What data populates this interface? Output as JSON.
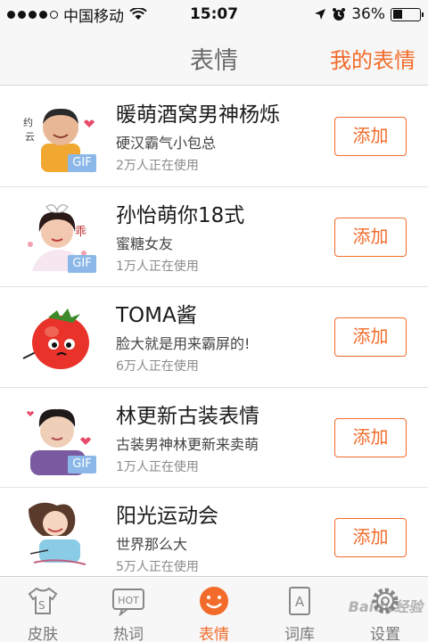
{
  "status_bar": {
    "carrier": "中国移动",
    "time": "15:07",
    "battery": "36%",
    "battery_level": 0.36
  },
  "nav": {
    "title": "表情",
    "right_action": "我的表情"
  },
  "items": [
    {
      "title": "暖萌酒窝男神杨烁",
      "subtitle": "硬汉霸气小包总",
      "users": "2万人正在使用",
      "badge": "GIF",
      "button": "添加"
    },
    {
      "title": "孙怡萌你18式",
      "subtitle": "蜜糖女友",
      "users": "1万人正在使用",
      "badge": "GIF",
      "button": "添加"
    },
    {
      "title": "TOMA酱",
      "subtitle": "脸大就是用来霸屏的!",
      "users": "6万人正在使用",
      "badge": "",
      "button": "添加"
    },
    {
      "title": "林更新古装表情",
      "subtitle": "古装男神林更新来卖萌",
      "users": "1万人正在使用",
      "badge": "GIF",
      "button": "添加"
    },
    {
      "title": "阳光运动会",
      "subtitle": "世界那么大",
      "users": "5万人正在使用",
      "badge": "",
      "button": "添加"
    }
  ],
  "tabs": [
    {
      "label": "皮肤",
      "icon": "tshirt-icon"
    },
    {
      "label": "热词",
      "icon": "hot-icon",
      "icon_text": "HOT"
    },
    {
      "label": "表情",
      "icon": "smiley-icon",
      "active": true
    },
    {
      "label": "词库",
      "icon": "dictionary-icon",
      "icon_text": "A"
    },
    {
      "label": "设置",
      "icon": "gear-icon"
    }
  ],
  "watermark": "Baidu经验",
  "colors": {
    "accent": "#f26b2a",
    "gif_badge": "#8bb8e8",
    "tomato": "#e8322a"
  }
}
